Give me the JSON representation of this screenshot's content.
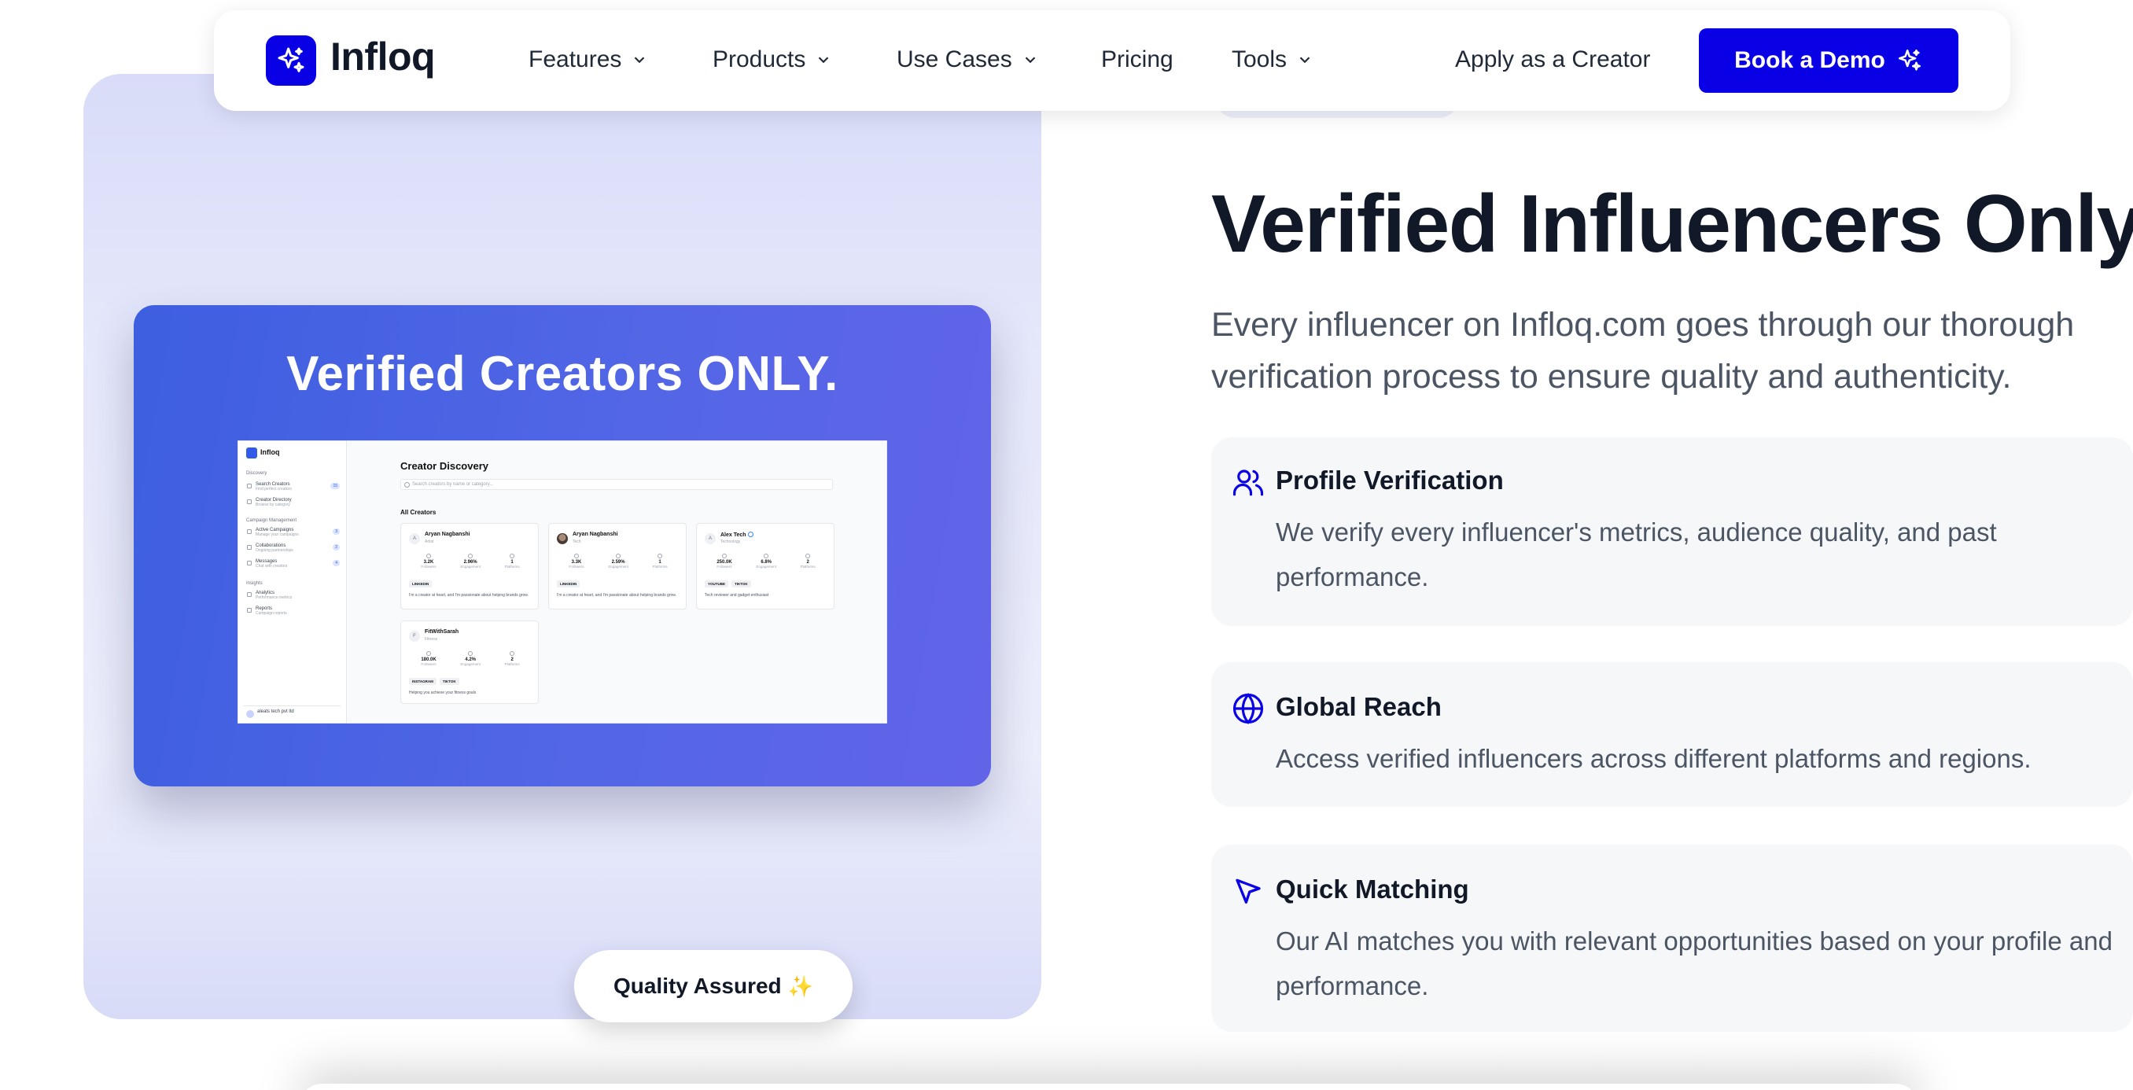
{
  "brand": {
    "name": "Infloq",
    "accent": "#0a00e6"
  },
  "nav": {
    "items": [
      {
        "label": "Features",
        "has_dropdown": true
      },
      {
        "label": "Products",
        "has_dropdown": true
      },
      {
        "label": "Use Cases",
        "has_dropdown": true
      },
      {
        "label": "Pricing",
        "has_dropdown": false
      },
      {
        "label": "Tools",
        "has_dropdown": true
      }
    ],
    "apply_label": "Apply as a Creator",
    "cta_label": "Book a Demo",
    "cta_icon": "sparkles-icon"
  },
  "showcase": {
    "title": "Verified Creators ONLY.",
    "badge_label": "Quality Assured",
    "badge_icon": "✨",
    "app": {
      "brand": "Infloq",
      "sections": [
        {
          "title": "Discovery",
          "items": [
            {
              "label": "Search Creators",
              "sub": "Find perfect creators",
              "badge": "15"
            },
            {
              "label": "Creator Directory",
              "sub": "Browse by category",
              "badge": ""
            }
          ]
        },
        {
          "title": "Campaign Management",
          "items": [
            {
              "label": "Active Campaigns",
              "sub": "Manage your campaigns",
              "badge": "3"
            },
            {
              "label": "Collaborations",
              "sub": "Ongoing partnerships",
              "badge": "2"
            },
            {
              "label": "Messages",
              "sub": "Chat with creators",
              "badge": "4"
            }
          ]
        },
        {
          "title": "Insights",
          "items": [
            {
              "label": "Analytics",
              "sub": "Performance metrics",
              "badge": ""
            },
            {
              "label": "Reports",
              "sub": "Campaign reports",
              "badge": ""
            }
          ]
        }
      ],
      "user": "aleats tech pvt ltd",
      "page_title": "Creator Discovery",
      "search_placeholder": "Search creators by name or category...",
      "list_title": "All Creators",
      "creators": [
        {
          "name": "Aryan Nagbanshi",
          "category": "Artist",
          "followers": "3.2K",
          "engagement": "2.96%",
          "platforms": "1",
          "tags": [
            "LINKEDIN"
          ],
          "bio": "I'm a creator at heart, and I'm passionate about helping brands grow."
        },
        {
          "name": "Aryan Nagbanshi",
          "category": "Tech",
          "followers": "3.3K",
          "engagement": "2.59%",
          "platforms": "1",
          "tags": [
            "LINKEDIN"
          ],
          "bio": "I'm a creator at heart, and I'm passionate about helping brands grow."
        },
        {
          "name": "Alex Tech",
          "category": "Technology",
          "followers": "250.0K",
          "engagement": "6.8%",
          "platforms": "2",
          "tags": [
            "YOUTUBE",
            "TIKTOK"
          ],
          "bio": "Tech reviewer and gadget enthusiast"
        },
        {
          "name": "FitWithSarah",
          "category": "Fitness",
          "followers": "180.0K",
          "engagement": "4.2%",
          "platforms": "2",
          "tags": [
            "INSTAGRAM",
            "TIKTOK"
          ],
          "bio": "Helping you achieve your fitness goals"
        }
      ],
      "stat_labels": {
        "followers": "Followers",
        "engagement": "Engagement",
        "platforms": "Platforms"
      }
    }
  },
  "hero": {
    "title": "Verified Influencers Only",
    "description": "Every influencer on Infloq.com goes through our thorough verification process to ensure quality and authenticity."
  },
  "features": [
    {
      "icon": "users-icon",
      "title": "Profile Verification",
      "description": "We verify every influencer's metrics, audience quality, and past performance."
    },
    {
      "icon": "globe-icon",
      "title": "Global Reach",
      "description": "Access verified influencers across different platforms and regions."
    },
    {
      "icon": "cursor-arrow-icon",
      "title": "Quick Matching",
      "description": "Our AI matches you with relevant opportunities based on your profile and performance."
    }
  ]
}
